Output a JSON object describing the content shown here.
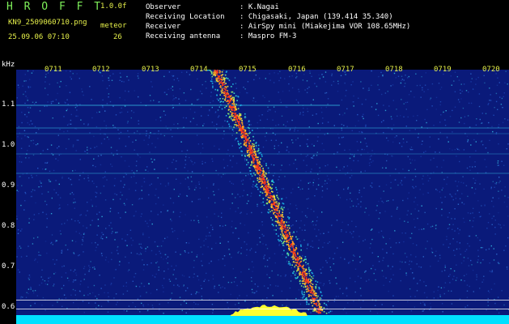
{
  "app": {
    "brand": "H R O F F T",
    "version": "1.0.0f",
    "filename": "KN9_2509060710.png",
    "mode": "meteor",
    "timestamp": "25.09.06 07:10",
    "count": "26"
  },
  "info": {
    "labels": [
      "Observer",
      "Receiving Location",
      "Receiver",
      "Receiving antenna"
    ],
    "values": [
      ": K.Nagai",
      ": Chigasaki, Japan (139.414 35.340)",
      ": AirSpy mini (Miakejima VOR 108.65MHz)",
      ": Maspro FM-3"
    ]
  },
  "time_axis": {
    "labels": [
      "0711",
      "0712",
      "0713",
      "0714",
      "0715",
      "0716",
      "0717",
      "0718",
      "0719",
      "0720"
    ]
  },
  "freq_axis": {
    "unit": "kHz",
    "labels": [
      "1.1",
      "1.0",
      "0.9",
      "0.8",
      "0.7",
      "0.6"
    ]
  },
  "colors": {
    "background": "#0a1a7a",
    "noise_hi": "#2fa8d8",
    "trail": "#ff3a1a",
    "baseline": "#00e0ff",
    "burst": "#ffff30"
  }
}
